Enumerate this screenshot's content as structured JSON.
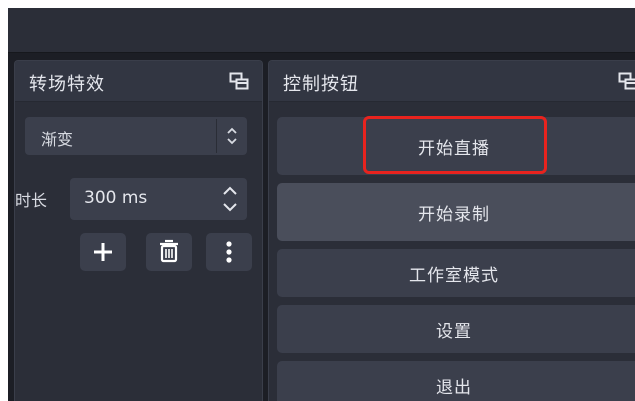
{
  "transition_dock": {
    "title": "转场特效",
    "transition_combo": {
      "value": "渐变"
    },
    "duration_label": "时长",
    "duration_value": "300 ms",
    "icons": {
      "float": "float-dock-icon",
      "add": "plus-icon",
      "delete": "trash-icon",
      "more": "more-vertical-icon"
    }
  },
  "controls_dock": {
    "title": "控制按钮",
    "buttons": {
      "start_stream": "开始直播",
      "start_record": "开始录制",
      "studio_mode": "工作室模式",
      "settings": "设置",
      "exit": "退出"
    }
  },
  "colors": {
    "window_bg": "#1c1e25",
    "panel_bg": "#2b2e38",
    "button_bg": "#3b3f4c",
    "button_hover_bg": "#4a4e5b",
    "text": "#e4e6ec",
    "highlight": "#e8231e"
  }
}
